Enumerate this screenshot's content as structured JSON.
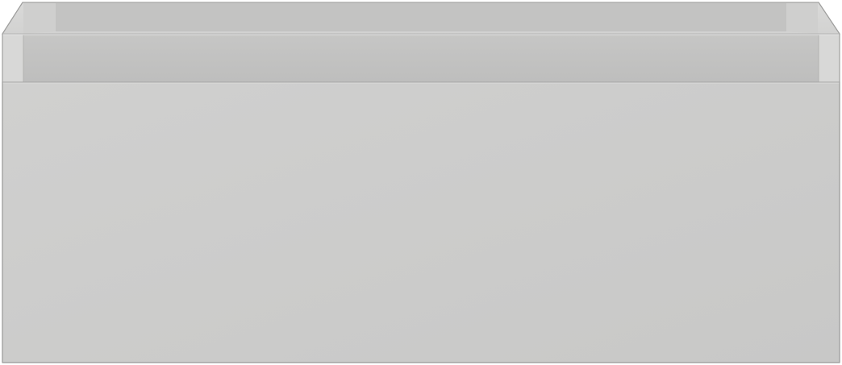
{
  "product": {
    "type": "drawer-unit-render",
    "colors": {
      "front": "#cccccb",
      "front_edge": "#bdbdbc",
      "side_panel": "#d6d6d5",
      "inner_wall": "#c4c4c3",
      "back_panel": "#c1c1c0",
      "rim": "#dcdcdb",
      "outline": "#a9a9a8",
      "background": "#ffffff"
    }
  }
}
